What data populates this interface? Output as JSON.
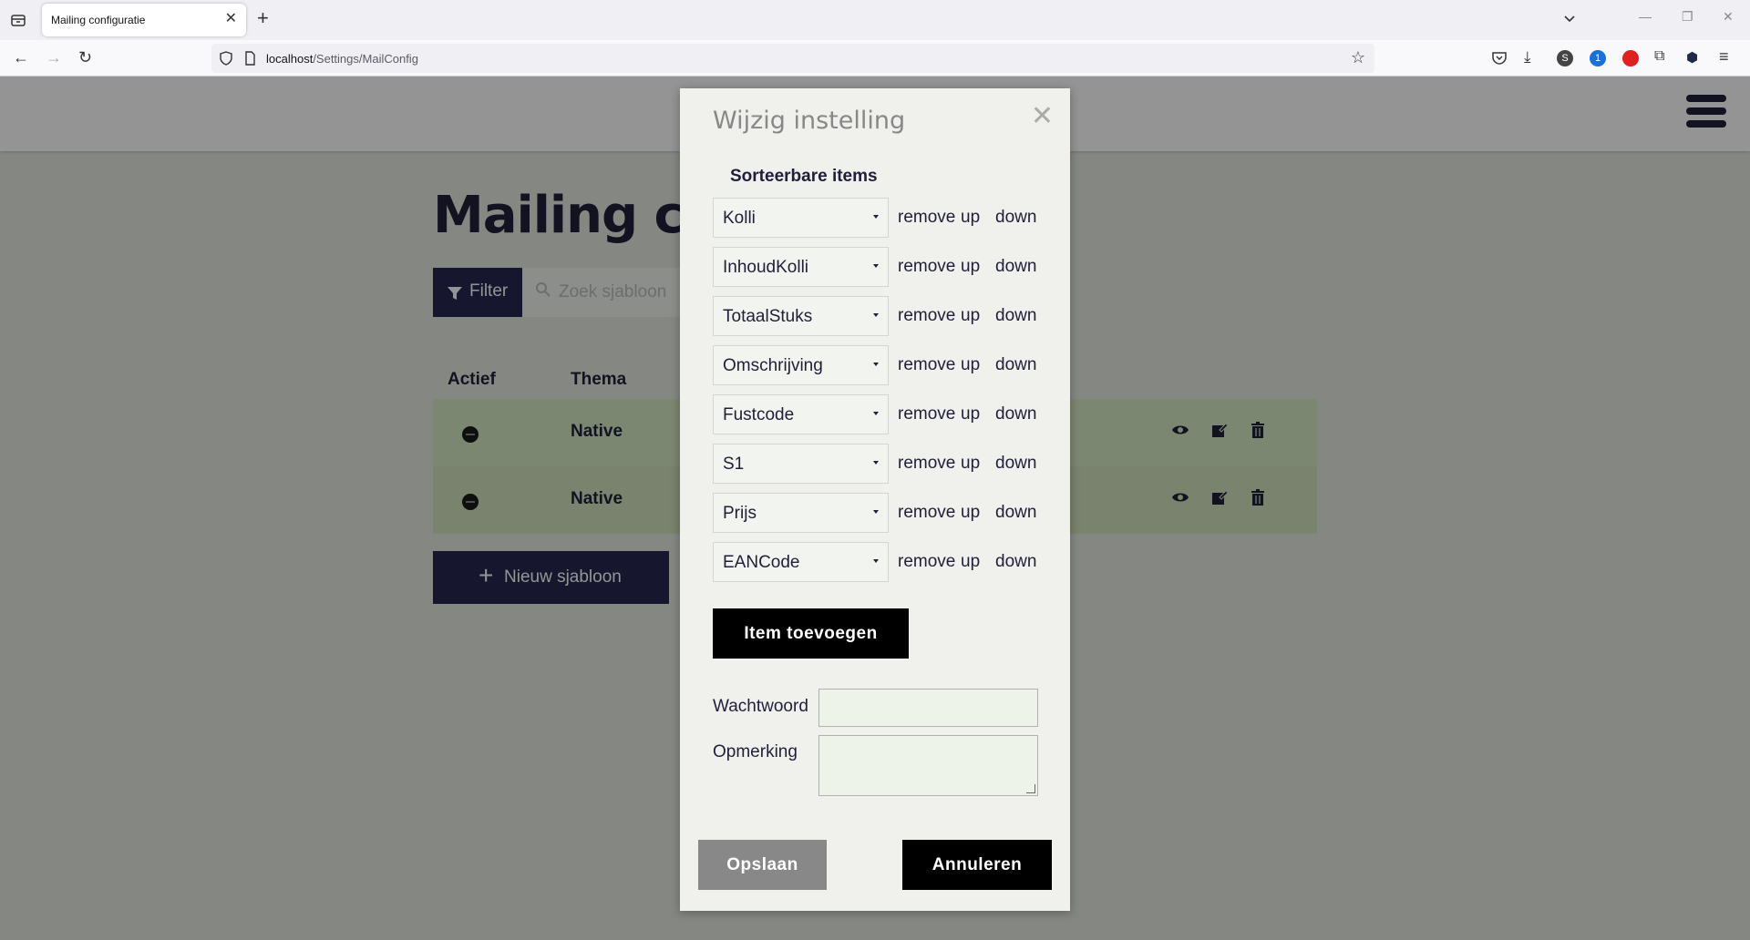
{
  "browser": {
    "tab_title": "Mailing configuratie",
    "url_host": "localhost",
    "url_path": "/Settings/MailConfig"
  },
  "page": {
    "title": "Mailing co",
    "filter_label": "Filter",
    "search_placeholder": "Zoek sjabloon",
    "columns": [
      "Actief",
      "Thema"
    ],
    "rows": [
      {
        "theme": "Native"
      },
      {
        "theme": "Native"
      }
    ],
    "new_template_label": "Nieuw sjabloon"
  },
  "modal": {
    "title": "Wijzig instelling",
    "section_title": "Sorteerbare items",
    "items": [
      {
        "value": "Kolli"
      },
      {
        "value": "InhoudKolli"
      },
      {
        "value": "TotaalStuks"
      },
      {
        "value": "Omschrijving"
      },
      {
        "value": "Fustcode"
      },
      {
        "value": "S1"
      },
      {
        "value": "Prijs"
      },
      {
        "value": "EANCode"
      }
    ],
    "remove_label": "remove",
    "up_label": "up",
    "down_label": "down",
    "add_item_label": "Item toevoegen",
    "password_label": "Wachtwoord",
    "remark_label": "Opmerking",
    "save_label": "Opslaan",
    "cancel_label": "Annuleren"
  },
  "colors": {
    "primary": "#272850",
    "row_background": "#d6e8c4",
    "modal_background": "#f0f0ed"
  }
}
